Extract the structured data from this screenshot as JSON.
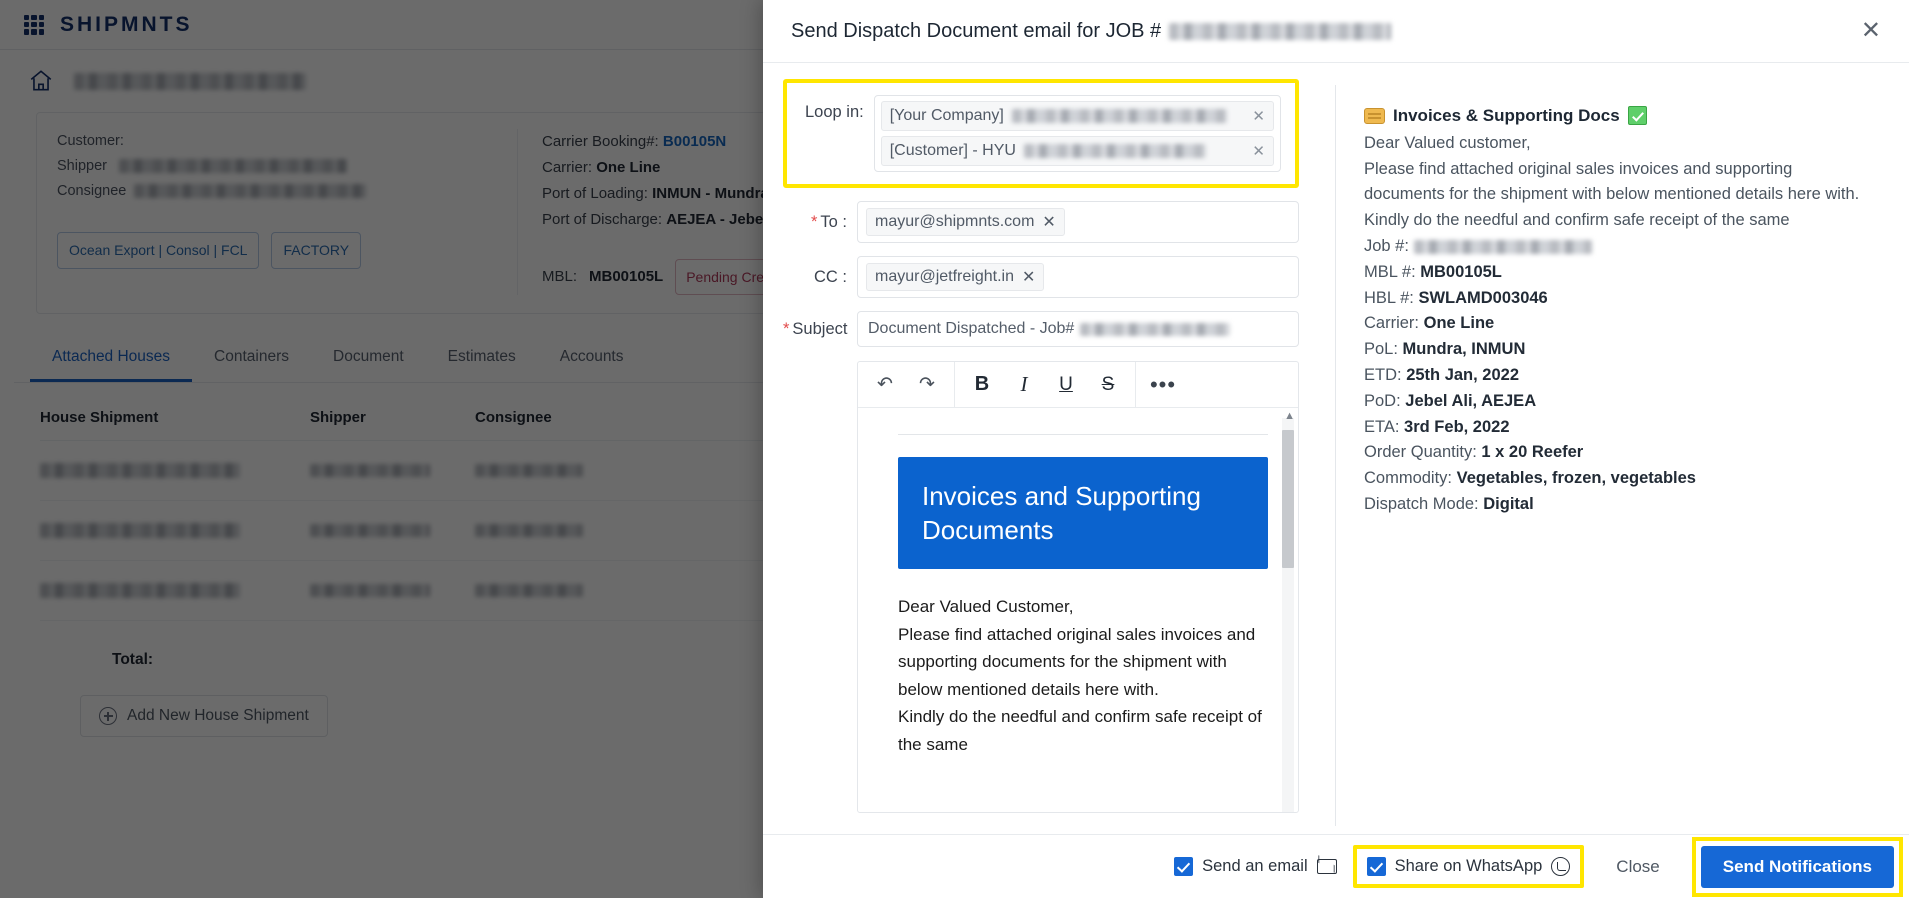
{
  "app": {
    "brand": "SHIPMNTS",
    "job_select_label": "Job #",
    "breadcrumb_masked": true,
    "card": {
      "customer_label": "Customer:",
      "shipper_label": "Shipper",
      "consignee_label": "Consignee",
      "carrier_booking_label": "Carrier Booking#:",
      "carrier_booking_value": "B00105N",
      "carrier_label": "Carrier:",
      "carrier_value": "One Line",
      "pol_label": "Port of Loading:",
      "pol_value": "INMUN - Mundra",
      "pod_label": "Port of Discharge:",
      "pod_value": "AEJEA - Jebel Ali",
      "tags": [
        "Ocean Export | Consol | FCL",
        "FACTORY"
      ],
      "mbl_label": "MBL:",
      "mbl_value": "MB00105L",
      "mbl_status": "Pending Creation"
    },
    "tabs": [
      "Attached Houses",
      "Containers",
      "Document",
      "Estimates",
      "Accounts"
    ],
    "active_tab": "Attached Houses",
    "table": {
      "headers": [
        "House Shipment",
        "Shipper",
        "Consignee"
      ],
      "rows": [
        {
          "house_shipment": "",
          "shipper": "",
          "consignee": ""
        },
        {
          "house_shipment": "",
          "shipper": "",
          "consignee": ""
        },
        {
          "house_shipment": "",
          "shipper": "",
          "consignee": ""
        }
      ]
    },
    "total_label": "Total:",
    "add_house_label": "Add New House Shipment"
  },
  "modal": {
    "title_prefix": "Send Dispatch Document email for JOB #",
    "close_icon": "close-icon",
    "loop_in": {
      "label": "Loop in:",
      "chips": [
        {
          "prefix": "[Your Company]",
          "masked": true
        },
        {
          "prefix": "[Customer] - HYU",
          "masked": true
        }
      ],
      "highlighted": true
    },
    "to": {
      "label": "To :",
      "required": true,
      "chips": [
        "mayur@shipmnts.com"
      ]
    },
    "cc": {
      "label": "CC :",
      "required": false,
      "chips": [
        "mayur@jetfreight.in"
      ]
    },
    "subject": {
      "label": "Subject",
      "required": true,
      "value": "Document Dispatched - Job#",
      "masked_suffix": true
    },
    "editor": {
      "toolbar": [
        {
          "name": "undo-icon",
          "glyph": "↶"
        },
        {
          "name": "redo-icon",
          "glyph": "↷"
        },
        {
          "name": "bold-icon",
          "glyph": "B"
        },
        {
          "name": "italic-icon",
          "glyph": "I"
        },
        {
          "name": "underline-icon",
          "glyph": "U"
        },
        {
          "name": "strikethrough-icon",
          "glyph": "S"
        },
        {
          "name": "more-options-icon",
          "glyph": "•••"
        }
      ],
      "banner_text": "Invoices and Supporting Documents",
      "banner_color": "#0b63ce",
      "body_lines": [
        "Dear Valued Customer,",
        "Please find attached original sales invoices and supporting documents for the shipment with below mentioned details here with.",
        "Kindly do the needful and confirm safe receipt of the same"
      ]
    },
    "preview": {
      "heading": "Invoices & Supporting Docs",
      "heading_icon": "document-icon",
      "check_icon": "green-check-icon",
      "greeting": "Dear Valued customer,",
      "paragraph": "Please find attached original sales invoices and supporting documents for the shipment with below mentioned details here with.",
      "line2": "Kindly do the needful and confirm safe receipt of the same",
      "fields": [
        {
          "label": "Job #:",
          "value": "",
          "masked": true
        },
        {
          "label": "MBL #:",
          "value": "MB00105L",
          "masked": false
        },
        {
          "label": "HBL #:",
          "value": "SWLAMD003046",
          "masked": false
        },
        {
          "label": "Carrier:",
          "value": "One Line",
          "masked": false
        },
        {
          "label": "PoL:",
          "value": "Mundra, INMUN",
          "masked": false
        },
        {
          "label": "ETD:",
          "value": "25th Jan, 2022",
          "masked": false
        },
        {
          "label": "PoD:",
          "value": "Jebel Ali, AEJEA",
          "masked": false
        },
        {
          "label": "ETA:",
          "value": "3rd Feb, 2022",
          "masked": false
        },
        {
          "label": "Order Quantity:",
          "value": "1 x 20 Reefer",
          "masked": false
        },
        {
          "label": "Commodity:",
          "value": "Vegetables, frozen, vegetables",
          "masked": false
        },
        {
          "label": "Dispatch Mode:",
          "value": "Digital",
          "masked": false
        }
      ]
    },
    "footer": {
      "send_email_label": "Send an email",
      "send_email_checked": true,
      "share_whatsapp_label": "Share on WhatsApp",
      "share_whatsapp_checked": true,
      "share_whatsapp_highlighted": true,
      "close_label": "Close",
      "send_label": "Send Notifications",
      "send_highlighted": true,
      "accent_color": "#1668d6",
      "highlight_color": "#ffe600"
    }
  }
}
